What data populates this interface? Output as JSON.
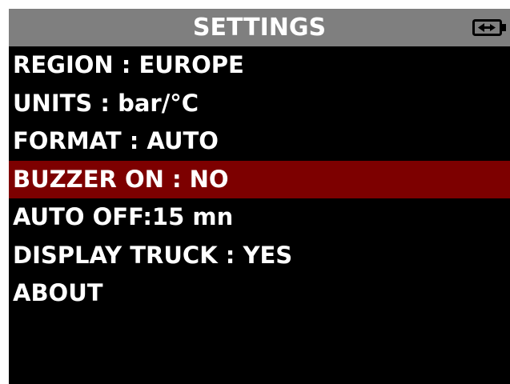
{
  "header": {
    "title": "SETTINGS",
    "battery_icon": "battery-icon"
  },
  "menu": {
    "selected_index": 3,
    "items": [
      {
        "label": "REGION : EUROPE"
      },
      {
        "label": "UNITS : bar/°C"
      },
      {
        "label": "FORMAT : AUTO"
      },
      {
        "label": "BUZZER ON : NO"
      },
      {
        "label": "AUTO OFF:15 mn"
      },
      {
        "label": "DISPLAY TRUCK : YES"
      },
      {
        "label": "ABOUT"
      }
    ]
  },
  "colors": {
    "screen_background": "#000000",
    "title_bar": "#7f7f7f",
    "selection_highlight": "#7d0000",
    "text": "#ffffff"
  }
}
